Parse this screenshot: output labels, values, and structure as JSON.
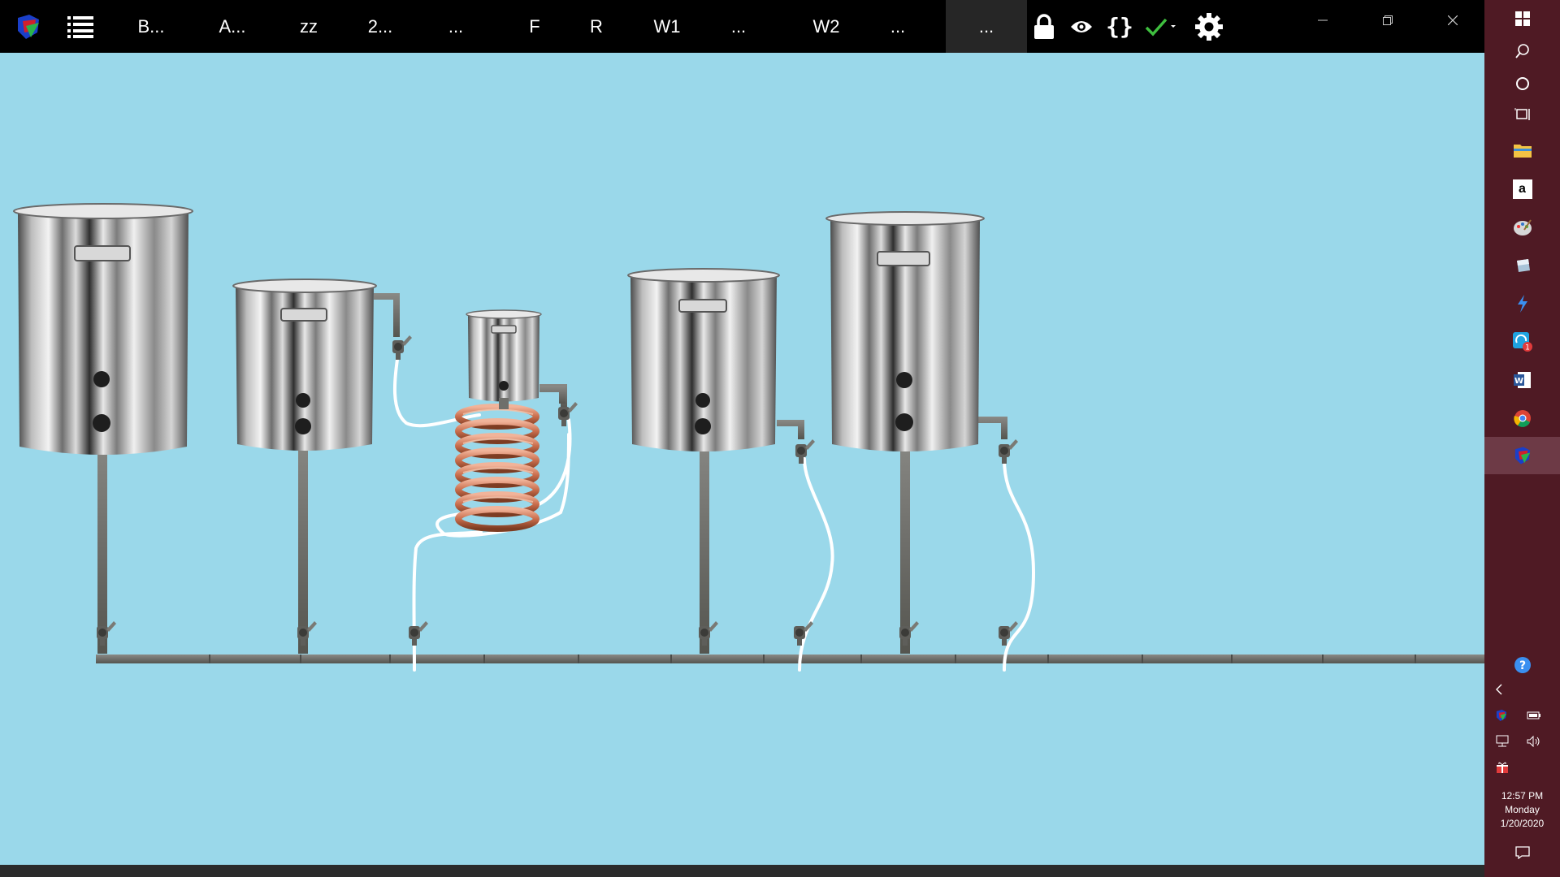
{
  "toolbar": {
    "tabs": [
      {
        "label": "B..."
      },
      {
        "label": "A..."
      },
      {
        "label": "zz"
      },
      {
        "label": "2..."
      },
      {
        "label": "..."
      },
      {
        "label": "F"
      },
      {
        "label": "R"
      },
      {
        "label": "W1"
      },
      {
        "label": "..."
      },
      {
        "label": "W2"
      },
      {
        "label": "..."
      },
      {
        "label": "..."
      }
    ],
    "icons": [
      "app-logo-icon",
      "list-icon",
      "lock-icon",
      "eye-icon",
      "braces-icon",
      "checkmark-icon",
      "gear-icon"
    ],
    "colors": {
      "background": "#000000",
      "active_tab": "#262626",
      "check": "#3fbf3f"
    }
  },
  "canvas": {
    "background": "#9ad8ea",
    "items": [
      "kettle",
      "kettle",
      "chiller-pot",
      "copper-coil",
      "kettle",
      "kettle",
      "valve",
      "hose",
      "main-pipe"
    ]
  },
  "taskbar": {
    "apps": [
      "windows-start-icon",
      "search-icon",
      "cortana-icon",
      "task-view-icon",
      "file-explorer-icon",
      "amazon-icon",
      "paint-icon",
      "eraser-icon",
      "lightning-icon",
      "edge-icon",
      "word-icon",
      "chrome-icon",
      "brew-app-icon"
    ],
    "edge_badge": "1",
    "tray": [
      "help-icon",
      "chevron-left-icon",
      "brew-tray-icon",
      "battery-icon",
      "network-icon",
      "volume-icon",
      "gift-icon",
      "notification-icon"
    ],
    "time": "12:57 PM",
    "day": "Monday",
    "date": "1/20/2020",
    "colors": {
      "background": "#4f1a24"
    }
  }
}
